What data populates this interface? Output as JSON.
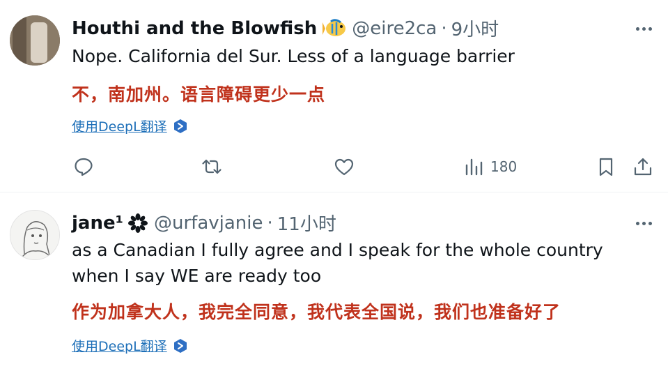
{
  "colors": {
    "translation": "#c0321c",
    "link": "#1d6fb8",
    "muted": "#536471"
  },
  "tweets": [
    {
      "display_name": "Houthi and the Blowfish",
      "name_emoji": "tropical-fish-emoji",
      "handle": "@eire2ca",
      "separator": "·",
      "time": "9小时",
      "text": "Nope. California del Sur. Less of a language barrier",
      "translation": "不，南加州。语言障碍更少一点",
      "translate_link": "使用DeepL翻译",
      "actions": {
        "views": "180"
      }
    },
    {
      "display_name": "jane¹",
      "name_emoji": "flower-emoji",
      "handle": "@urfavjanie",
      "separator": "·",
      "time": "11小时",
      "text_lines": [
        "as a Canadian I fully agree and I speak for the whole country",
        "when I say WE are ready too"
      ],
      "translation": "作为加拿大人，我完全同意，我代表全国说，我们也准备好了",
      "translate_link": "使用DeepL翻译"
    }
  ]
}
